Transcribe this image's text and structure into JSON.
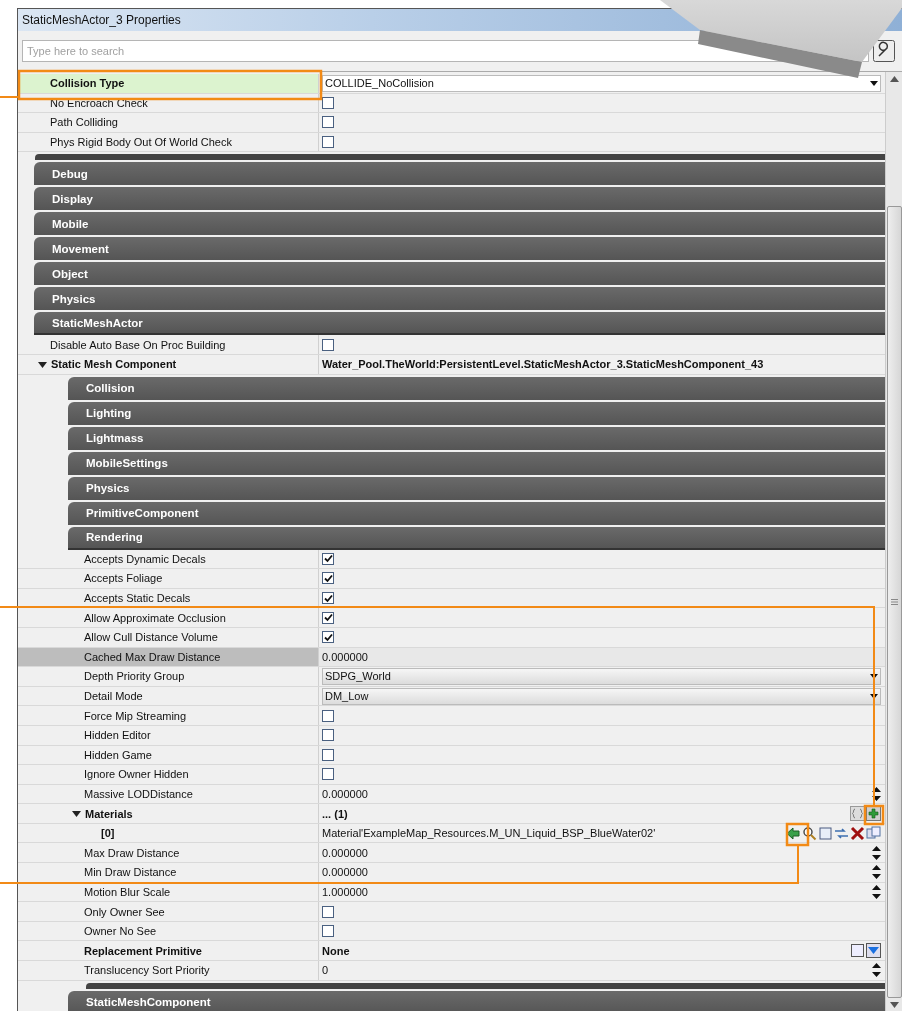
{
  "window": {
    "title": "StaticMeshActor_3 Properties"
  },
  "search": {
    "placeholder": "Type here to search"
  },
  "properties": [
    {
      "kind": "property",
      "label": "Collision Type",
      "bold": true,
      "selected": false,
      "focused": true,
      "value": {
        "kind": "dropdown",
        "text": "COLLIDE_NoCollision"
      }
    },
    {
      "kind": "property",
      "label": "No Encroach Check",
      "bold": false,
      "selected": false,
      "focused": false,
      "value": {
        "kind": "checkbox",
        "checked": false
      }
    },
    {
      "kind": "property",
      "label": "Path Colliding",
      "bold": false,
      "selected": false,
      "focused": false,
      "value": {
        "kind": "checkbox",
        "checked": false
      }
    },
    {
      "kind": "property",
      "label": "Phys Rigid Body Out Of World Check",
      "bold": false,
      "selected": false,
      "focused": false,
      "value": {
        "kind": "checkbox",
        "checked": false
      }
    },
    {
      "kind": "group_end"
    },
    {
      "kind": "category",
      "label": "Debug",
      "expanded": false
    },
    {
      "kind": "category",
      "label": "Display",
      "expanded": false
    },
    {
      "kind": "category",
      "label": "Mobile",
      "expanded": false
    },
    {
      "kind": "category",
      "label": "Movement",
      "expanded": false
    },
    {
      "kind": "category",
      "label": "Object",
      "expanded": false
    },
    {
      "kind": "category",
      "label": "Physics",
      "expanded": false
    },
    {
      "kind": "category",
      "label": "StaticMeshActor",
      "expanded": true,
      "children": [
        {
          "kind": "property",
          "label": "Disable Auto Base On Proc Building",
          "bold": false,
          "selected": false,
          "focused": false,
          "value": {
            "kind": "checkbox",
            "checked": false
          }
        },
        {
          "kind": "property",
          "label": "Static Mesh Component",
          "bold": true,
          "selected": false,
          "focused": false,
          "expanded": true,
          "value": {
            "kind": "object",
            "text": "Water_Pool.TheWorld:PersistentLevel.StaticMeshActor_3.StaticMeshComponent_43"
          },
          "children": [
            {
              "kind": "category",
              "label": "Collision",
              "expanded": false
            },
            {
              "kind": "category",
              "label": "Lighting",
              "expanded": false
            },
            {
              "kind": "category",
              "label": "Lightmass",
              "expanded": false
            },
            {
              "kind": "category",
              "label": "MobileSettings",
              "expanded": false
            },
            {
              "kind": "category",
              "label": "Physics",
              "expanded": false
            },
            {
              "kind": "category",
              "label": "PrimitiveComponent",
              "expanded": false
            },
            {
              "kind": "category",
              "label": "Rendering",
              "expanded": true,
              "children": [
                {
                  "kind": "property",
                  "label": "Accepts Dynamic Decals",
                  "bold": false,
                  "selected": false,
                  "focused": false,
                  "value": {
                    "kind": "checkbox",
                    "checked": true
                  }
                },
                {
                  "kind": "property",
                  "label": "Accepts Foliage",
                  "bold": false,
                  "selected": false,
                  "focused": false,
                  "value": {
                    "kind": "checkbox",
                    "checked": true
                  }
                },
                {
                  "kind": "property",
                  "label": "Accepts Static Decals",
                  "bold": false,
                  "selected": false,
                  "focused": false,
                  "value": {
                    "kind": "checkbox",
                    "checked": true
                  }
                },
                {
                  "kind": "property",
                  "label": "Allow Approximate Occlusion",
                  "bold": false,
                  "selected": false,
                  "focused": false,
                  "value": {
                    "kind": "checkbox",
                    "checked": true
                  }
                },
                {
                  "kind": "property",
                  "label": "Allow Cull Distance Volume",
                  "bold": false,
                  "selected": false,
                  "focused": false,
                  "value": {
                    "kind": "checkbox",
                    "checked": true
                  }
                },
                {
                  "kind": "property",
                  "label": "Cached Max Draw Distance",
                  "bold": false,
                  "selected": true,
                  "focused": false,
                  "value": {
                    "kind": "text",
                    "text": "0.000000"
                  }
                },
                {
                  "kind": "property",
                  "label": "Depth Priority Group",
                  "bold": false,
                  "selected": false,
                  "focused": false,
                  "value": {
                    "kind": "dropdown",
                    "text": "SDPG_World"
                  }
                },
                {
                  "kind": "property",
                  "label": "Detail Mode",
                  "bold": false,
                  "selected": false,
                  "focused": false,
                  "value": {
                    "kind": "dropdown",
                    "text": "DM_Low"
                  }
                },
                {
                  "kind": "property",
                  "label": "Force Mip Streaming",
                  "bold": false,
                  "selected": false,
                  "focused": false,
                  "value": {
                    "kind": "checkbox",
                    "checked": false
                  }
                },
                {
                  "kind": "property",
                  "label": "Hidden Editor",
                  "bold": false,
                  "selected": false,
                  "focused": false,
                  "value": {
                    "kind": "checkbox",
                    "checked": false
                  }
                },
                {
                  "kind": "property",
                  "label": "Hidden Game",
                  "bold": false,
                  "selected": false,
                  "focused": false,
                  "value": {
                    "kind": "checkbox",
                    "checked": false
                  }
                },
                {
                  "kind": "property",
                  "label": "Ignore Owner Hidden",
                  "bold": false,
                  "selected": false,
                  "focused": false,
                  "value": {
                    "kind": "checkbox",
                    "checked": false
                  }
                },
                {
                  "kind": "property",
                  "label": "Massive LODDistance",
                  "bold": false,
                  "selected": false,
                  "focused": false,
                  "value": {
                    "kind": "number",
                    "text": "0.000000"
                  }
                },
                {
                  "kind": "property",
                  "label": "Materials",
                  "bold": true,
                  "selected": false,
                  "focused": false,
                  "expanded": true,
                  "value": {
                    "kind": "array",
                    "text": "... (1)"
                  },
                  "children": [
                    {
                      "kind": "property",
                      "label": "[0]",
                      "bold": true,
                      "selected": false,
                      "focused": false,
                      "value": {
                        "kind": "asset",
                        "text": "Material'ExampleMap_Resources.M_UN_Liquid_BSP_BlueWater02'"
                      }
                    }
                  ]
                },
                {
                  "kind": "property",
                  "label": "Max Draw Distance",
                  "bold": false,
                  "selected": false,
                  "focused": false,
                  "value": {
                    "kind": "number",
                    "text": "0.000000"
                  }
                },
                {
                  "kind": "property",
                  "label": "Min Draw Distance",
                  "bold": false,
                  "selected": false,
                  "focused": false,
                  "value": {
                    "kind": "number",
                    "text": "0.000000"
                  }
                },
                {
                  "kind": "property",
                  "label": "Motion Blur Scale",
                  "bold": false,
                  "selected": false,
                  "focused": false,
                  "value": {
                    "kind": "number",
                    "text": "1.000000"
                  }
                },
                {
                  "kind": "property",
                  "label": "Only Owner See",
                  "bold": false,
                  "selected": false,
                  "focused": false,
                  "value": {
                    "kind": "checkbox",
                    "checked": false
                  }
                },
                {
                  "kind": "property",
                  "label": "Owner No See",
                  "bold": false,
                  "selected": false,
                  "focused": false,
                  "value": {
                    "kind": "checkbox",
                    "checked": false
                  }
                },
                {
                  "kind": "property",
                  "label": "Replacement Primitive",
                  "bold": true,
                  "selected": false,
                  "focused": false,
                  "value": {
                    "kind": "object_picker",
                    "text": "None"
                  }
                },
                {
                  "kind": "property",
                  "label": "Translucency Sort Priority",
                  "bold": false,
                  "selected": false,
                  "focused": false,
                  "value": {
                    "kind": "number",
                    "text": "0"
                  }
                }
              ]
            },
            {
              "kind": "category",
              "label": "StaticMeshComponent",
              "expanded": false
            }
          ]
        }
      ]
    }
  ]
}
